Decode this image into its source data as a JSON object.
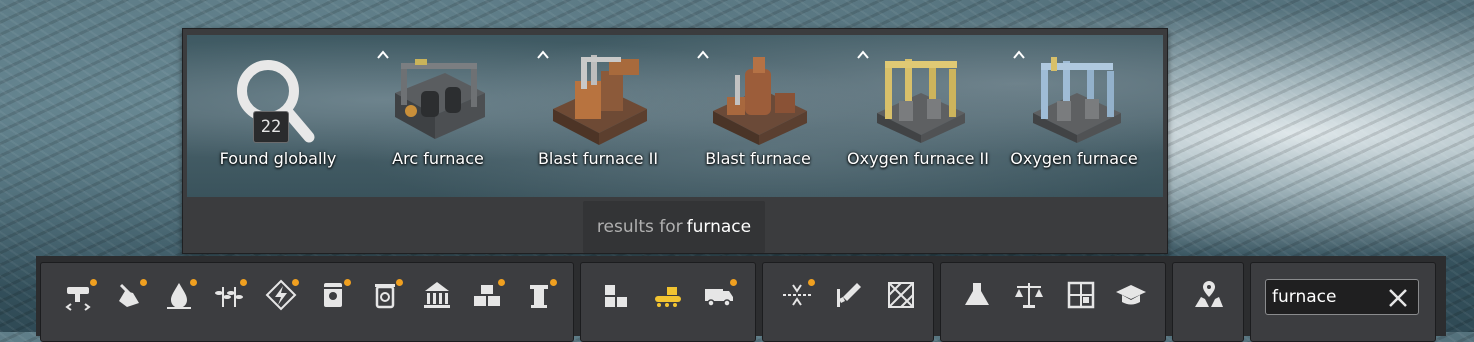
{
  "results": {
    "count": "22",
    "items": [
      {
        "label": "Found globally",
        "icon": "magnifier-icon"
      },
      {
        "label": "Arc furnace",
        "icon": "arc-furnace-icon"
      },
      {
        "label": "Blast furnace II",
        "icon": "blast-furnace-ii-icon"
      },
      {
        "label": "Blast furnace",
        "icon": "blast-furnace-icon"
      },
      {
        "label": "Oxygen furnace II",
        "icon": "oxygen-furnace-ii-icon"
      },
      {
        "label": "Oxygen furnace",
        "icon": "oxygen-furnace-icon"
      }
    ],
    "footer_prefix": "results for",
    "footer_query": "furnace"
  },
  "toolbar": {
    "groups": [
      {
        "buttons": [
          {
            "icon": "conveyor-icon",
            "notify": true
          },
          {
            "icon": "mining-icon",
            "notify": true
          },
          {
            "icon": "water-icon",
            "notify": true
          },
          {
            "icon": "farming-icon",
            "notify": true
          },
          {
            "icon": "power-icon",
            "notify": true
          },
          {
            "icon": "fuel-icon",
            "notify": true
          },
          {
            "icon": "recycle-icon",
            "notify": true
          },
          {
            "icon": "government-icon",
            "notify": false
          },
          {
            "icon": "storage-icon",
            "notify": true
          },
          {
            "icon": "pillar-icon",
            "notify": true
          }
        ]
      },
      {
        "buttons": [
          {
            "icon": "housing-icon",
            "notify": false
          },
          {
            "icon": "cargo-depot-icon",
            "notify": false,
            "active": true
          },
          {
            "icon": "vehicles-icon",
            "notify": true
          }
        ]
      },
      {
        "buttons": [
          {
            "icon": "transport-icon",
            "notify": true
          },
          {
            "icon": "rocket-icon",
            "notify": false
          },
          {
            "icon": "terrain-icon",
            "notify": false
          }
        ]
      },
      {
        "buttons": [
          {
            "icon": "research-icon",
            "notify": false
          },
          {
            "icon": "balance-icon",
            "notify": false
          },
          {
            "icon": "blueprints-icon",
            "notify": false
          },
          {
            "icon": "education-icon",
            "notify": false
          }
        ]
      },
      {
        "buttons": [
          {
            "icon": "map-icon",
            "notify": false
          }
        ]
      }
    ],
    "search": {
      "value": "furnace",
      "placeholder": ""
    },
    "colors": {
      "accent": "#f0a020",
      "active": "#f2c431",
      "icon": "#e6e6e6"
    }
  }
}
